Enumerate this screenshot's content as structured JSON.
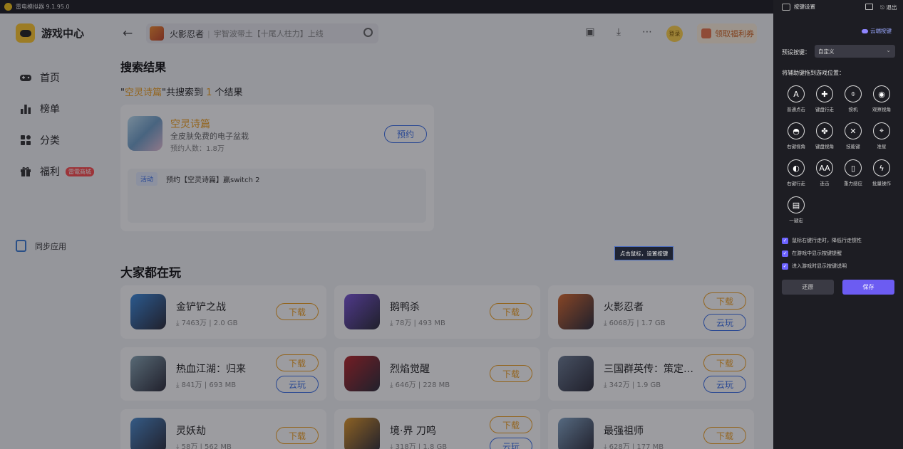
{
  "window": {
    "title": "雷电模拟器 9.1.95.0"
  },
  "sidebar": {
    "brand": "游戏中心",
    "items": [
      {
        "label": "首页",
        "icon": "gamepad-icon"
      },
      {
        "label": "榜单",
        "icon": "chart-icon"
      },
      {
        "label": "分类",
        "icon": "category-icon"
      },
      {
        "label": "福利",
        "icon": "gift-icon",
        "badge": "雷電商城"
      }
    ],
    "sync_label": "同步应用"
  },
  "topbar": {
    "search_game": "火影忍者",
    "search_hint": "宇智波带土【十尾人柱力】上线",
    "login": "登录",
    "welfare": "领取福利券"
  },
  "search": {
    "section_title": "搜索结果",
    "query": "空灵诗篇",
    "result_prefix": "\"",
    "result_mid": "\"共搜索到",
    "result_count": "1",
    "result_suffix": "个结果",
    "result": {
      "name": "空灵诗篇",
      "desc": "全皮肤免费的电子盆栽",
      "reservations": "预约人数：1.8万",
      "button": "预约",
      "activity_tag": "活动",
      "activity_text": "预约【空灵诗篇】赢switch 2"
    }
  },
  "popular": {
    "section_title": "大家都在玩",
    "download_label": "下载",
    "cloud_label": "云玩",
    "games": [
      {
        "name": "金铲铲之战",
        "meta": "⤓ 7463万 | 2.0 GB",
        "cloud": false,
        "color": "#3e8de0"
      },
      {
        "name": "鹅鸭杀",
        "meta": "⤓ 78万 | 493 MB",
        "cloud": false,
        "color": "#7a55d8"
      },
      {
        "name": "火影忍者",
        "meta": "⤓ 6068万 | 1.7 GB",
        "cloud": true,
        "color": "#d96a2e"
      },
      {
        "name": "热血江湖：归来",
        "meta": "⤓ 841万 | 693 MB",
        "cloud": true,
        "color": "#8aa8b6"
      },
      {
        "name": "烈焰觉醒",
        "meta": "⤓ 646万 | 228 MB",
        "cloud": false,
        "color": "#b8262a"
      },
      {
        "name": "三国群英传：策定九州",
        "meta": "⤓ 342万 | 1.9 GB",
        "cloud": true,
        "color": "#6d7d94"
      },
      {
        "name": "灵妖劫",
        "meta": "⤓ 58万 | 562 MB",
        "cloud": false,
        "color": "#4e8fd1"
      },
      {
        "name": "境·界 刀鸣",
        "meta": "⤓ 318万 | 1.8 GB",
        "cloud": true,
        "color": "#e39a2a"
      },
      {
        "name": "最强祖师",
        "meta": "⤓ 628万 | 177 MB",
        "cloud": false,
        "color": "#86a8c8"
      }
    ]
  },
  "hint": "点击鼠标，设置按键",
  "panel": {
    "title": "按键设置",
    "exit": "退出",
    "cloud_key": "云端按键",
    "preset_label": "预设按键：",
    "preset_value": "自定义",
    "drag_label": "将辅助键拖到游戏位置：",
    "keys": [
      {
        "glyph": "A",
        "label": "普通点击"
      },
      {
        "glyph": "✚",
        "label": "键盘行走"
      },
      {
        "glyph": "⌽",
        "label": "按机"
      },
      {
        "glyph": "◉",
        "label": "观察视角"
      },
      {
        "glyph": "◓",
        "label": "右键视角"
      },
      {
        "glyph": "✤",
        "label": "键盘视角"
      },
      {
        "glyph": "✕",
        "label": "技能键"
      },
      {
        "glyph": "⌖",
        "label": "准星"
      },
      {
        "glyph": "◐",
        "label": "右键行走"
      },
      {
        "glyph": "AA",
        "label": "连击"
      },
      {
        "glyph": "▯",
        "label": "重力感应"
      },
      {
        "glyph": "ϟ",
        "label": "批量操作"
      },
      {
        "glyph": "▤",
        "label": "一键宏"
      }
    ],
    "checks": [
      "鼠标右键行走时，降低行走惯性",
      "在游戏中显示按键提醒",
      "进入游戏时显示按键说明"
    ],
    "restore": "还原",
    "save": "保存"
  }
}
